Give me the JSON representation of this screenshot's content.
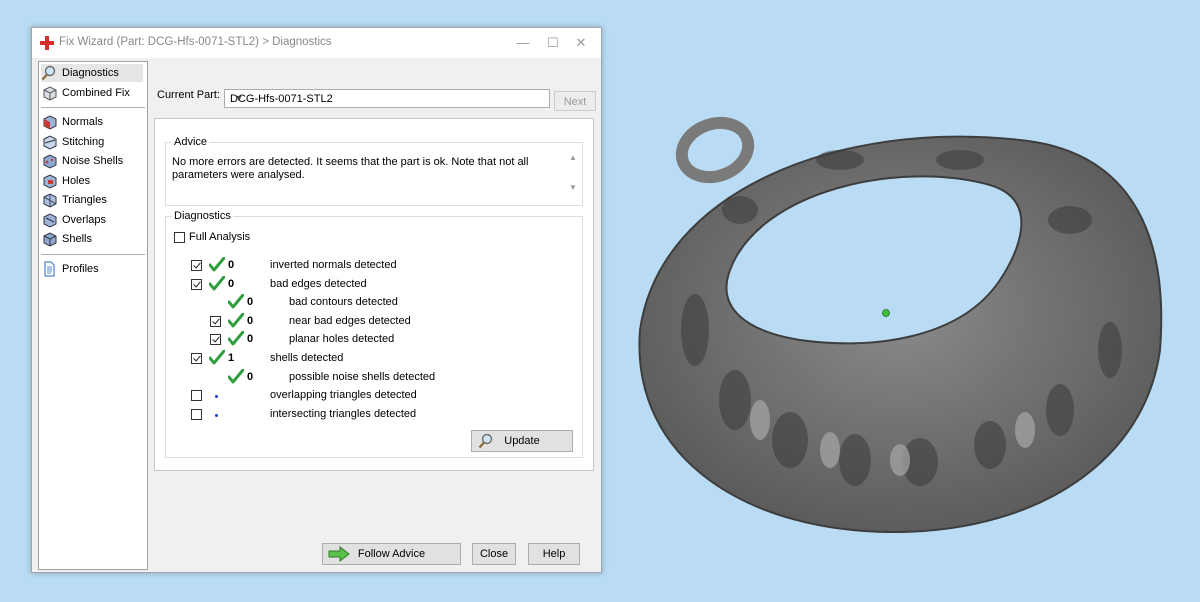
{
  "window": {
    "title": "Fix Wizard (Part: DCG-Hfs-0071-STL2) > Diagnostics"
  },
  "nav": {
    "items_top": [
      {
        "label": "Diagnostics",
        "icon": "magnifier-icon",
        "selected": true
      },
      {
        "label": "Combined Fix",
        "icon": "cube-icon"
      }
    ],
    "items_fix": [
      {
        "label": "Normals",
        "icon": "normals-icon"
      },
      {
        "label": "Stitching",
        "icon": "stitching-icon"
      },
      {
        "label": "Noise Shells",
        "icon": "noise-shells-icon"
      },
      {
        "label": "Holes",
        "icon": "holes-icon"
      },
      {
        "label": "Triangles",
        "icon": "triangles-icon"
      },
      {
        "label": "Overlaps",
        "icon": "overlaps-icon"
      },
      {
        "label": "Shells",
        "icon": "shells-icon"
      }
    ],
    "items_bottom": [
      {
        "label": "Profiles",
        "icon": "document-icon"
      }
    ]
  },
  "current_part": {
    "label": "Current Part:",
    "value": "DCG-Hfs-0071-STL2",
    "next_label": "Next"
  },
  "advice": {
    "title": "Advice",
    "text": "No more errors are detected. It seems that the part is ok. Note that not all parameters were analysed."
  },
  "diagnostics": {
    "title": "Diagnostics",
    "full_analysis_label": "Full Analysis",
    "full_analysis_checked": false,
    "rows": [
      {
        "count": "0",
        "label": "inverted normals detected",
        "checked": true,
        "status": "ok",
        "indent": 0
      },
      {
        "count": "0",
        "label": "bad edges detected",
        "checked": true,
        "status": "ok",
        "indent": 0
      },
      {
        "count": "0",
        "label": "bad contours detected",
        "checked": null,
        "status": "ok",
        "indent": 1
      },
      {
        "count": "0",
        "label": "near bad edges detected",
        "checked": true,
        "status": "ok",
        "indent": 1
      },
      {
        "count": "0",
        "label": "planar holes detected",
        "checked": true,
        "status": "ok",
        "indent": 1
      },
      {
        "count": "1",
        "label": "shells detected",
        "checked": true,
        "status": "ok",
        "indent": 0
      },
      {
        "count": "0",
        "label": "possible noise shells detected",
        "checked": null,
        "status": "ok",
        "indent": 1
      },
      {
        "count": "",
        "label": "overlapping triangles detected",
        "checked": false,
        "status": "pending",
        "indent": 0
      },
      {
        "count": "",
        "label": "intersecting triangles detected",
        "checked": false,
        "status": "pending",
        "indent": 0
      }
    ],
    "update_label": "Update"
  },
  "footer": {
    "follow_advice_label": "Follow Advice",
    "close_label": "Close",
    "help_label": "Help"
  },
  "colors": {
    "background": "#b9dcf4",
    "model_gray": "#6e6e6e",
    "check_green": "#2e9e3e",
    "pending_dot": "#1a3fd0"
  }
}
